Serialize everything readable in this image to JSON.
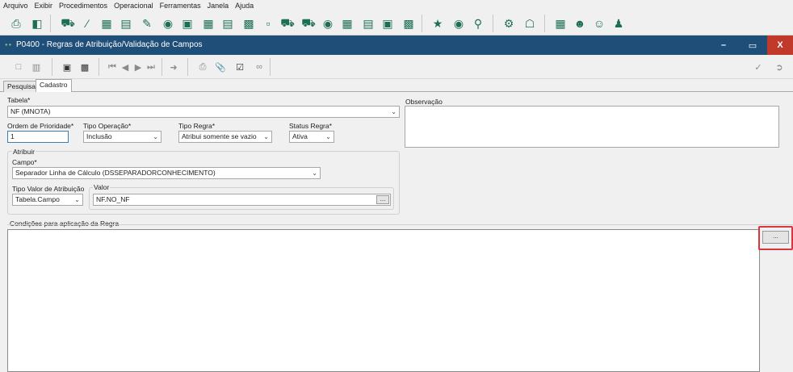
{
  "menu": [
    "Arquivo",
    "Exibir",
    "Procedimentos",
    "Operacional",
    "Ferramentas",
    "Janela",
    "Ajuda"
  ],
  "window": {
    "title": "P0400 - Regras de Atribuição/Validação de Campos",
    "minimize": "–",
    "maximize": "▭",
    "close": "X"
  },
  "tabs": [
    "Pesquisa",
    "Cadastro"
  ],
  "active_tab": "Cadastro",
  "form": {
    "tabela": {
      "label": "Tabela*",
      "value": "NF (MNOTA)"
    },
    "ordem": {
      "label": "Ordem de Prioridade*",
      "value": "1"
    },
    "tipo_operacao": {
      "label": "Tipo Operação*",
      "value": "Inclusão"
    },
    "tipo_regra": {
      "label": "Tipo Regra*",
      "value": "Atribui somente se vazio"
    },
    "status_regra": {
      "label": "Status Regra*",
      "value": "Ativa"
    },
    "observacao": {
      "label": "Observação",
      "value": ""
    },
    "atribuir": {
      "label": "Atribuir",
      "campo": {
        "label": "Campo*",
        "value": "Separador Linha de Cálculo (DSSEPARADORCONHECIMENTO)"
      },
      "tipo_valor": {
        "label": "Tipo Valor de Atribuição",
        "value": "Tabela.Campo"
      },
      "valor": {
        "label": "Valor",
        "value": "NF.NO_NF",
        "button": "..."
      }
    },
    "condicoes": {
      "label": "Condições para aplicação da Regra",
      "button": "..."
    }
  },
  "colors": {
    "titlebar": "#1f4e79",
    "close_button": "#c0392b",
    "highlight": "#d9363e",
    "toolbar_icons": "#1e6e52"
  }
}
